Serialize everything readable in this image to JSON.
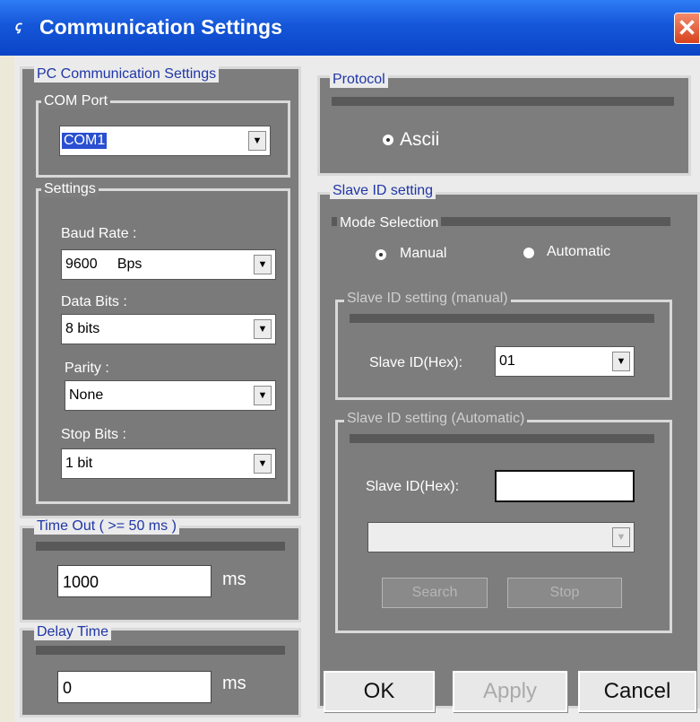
{
  "window": {
    "title": "Communication Settings",
    "close_glyph": "✕",
    "icon_text": "ꞔ"
  },
  "pc": {
    "legend": "PC Communication Settings",
    "com": {
      "legend": "COM Port",
      "value": "COM1"
    },
    "settings": {
      "legend": "Settings",
      "baud_label": "Baud Rate :",
      "baud_value": "9600     Bps",
      "databits_label": "Data Bits :",
      "databits_value": "8 bits",
      "parity_label": "Parity :",
      "parity_value": "None",
      "stopbits_label": "Stop Bits :",
      "stopbits_value": "1 bit"
    }
  },
  "timeout": {
    "legend": "Time Out ( >= 50 ms )",
    "value": "1000",
    "unit": "ms"
  },
  "delay": {
    "legend": "Delay Time",
    "value": "0",
    "unit": "ms"
  },
  "protocol": {
    "legend": "Protocol",
    "option": "Ascii"
  },
  "slave": {
    "legend": "Slave ID setting",
    "mode": {
      "legend": "Mode Selection",
      "manual": "Manual",
      "automatic": "Automatic",
      "selected": "manual"
    },
    "manual": {
      "legend": "Slave ID setting (manual)",
      "label": "Slave ID(Hex):",
      "value": "01"
    },
    "automatic": {
      "legend": "Slave ID setting (Automatic)",
      "label": "Slave ID(Hex):",
      "value": "",
      "combo_value": "",
      "search": "Search",
      "stop": "Stop"
    }
  },
  "buttons": {
    "ok": "OK",
    "apply": "Apply",
    "cancel": "Cancel"
  },
  "arrow_glyph": "▼"
}
